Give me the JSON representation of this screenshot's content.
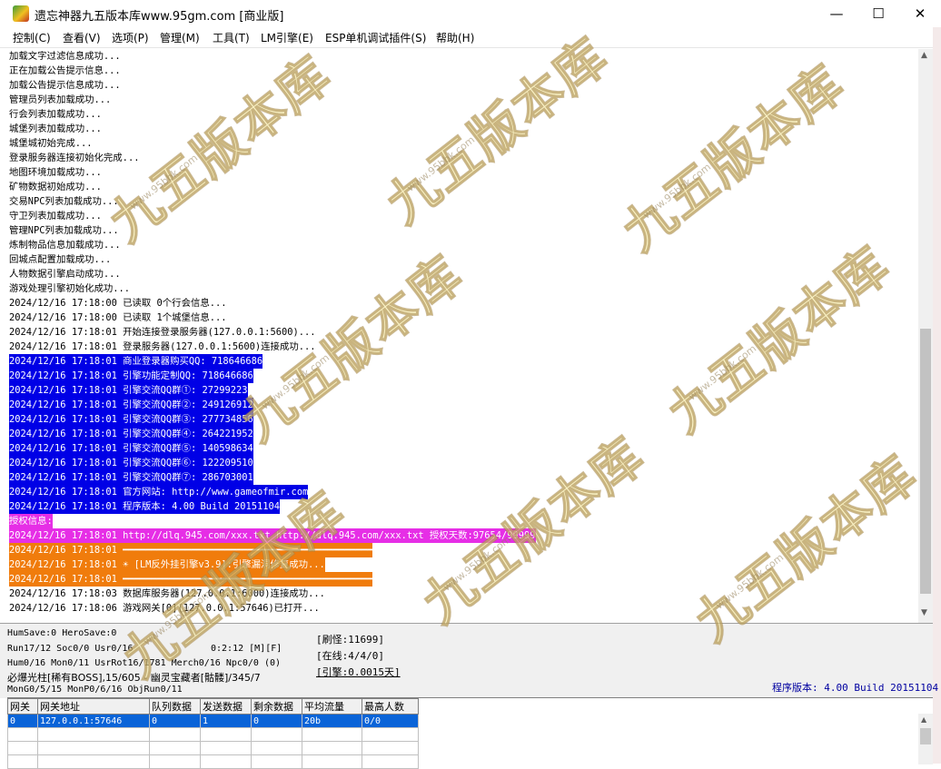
{
  "window": {
    "title": "遗忘神器九五版本库www.95gm.com [商业版]",
    "controls": {
      "minimize": "—",
      "maximize": "☐",
      "close": "✕"
    }
  },
  "menu": [
    {
      "label": "控制(C)"
    },
    {
      "label": "查看(V)"
    },
    {
      "label": "选项(P)"
    },
    {
      "label": "管理(M)"
    },
    {
      "label": "工具(T)"
    },
    {
      "label": "LM引擎(E)"
    },
    {
      "label": "ESP单机调试插件(S)"
    },
    {
      "label": "帮助(H)"
    }
  ],
  "log": [
    {
      "text": "加载文字过滤信息成功...",
      "style": "plain"
    },
    {
      "text": "正在加载公告提示信息...",
      "style": "plain"
    },
    {
      "text": "加载公告提示信息成功...",
      "style": "plain"
    },
    {
      "text": "管理员列表加载成功...",
      "style": "plain"
    },
    {
      "text": "行会列表加载成功...",
      "style": "plain"
    },
    {
      "text": "城堡列表加载成功...",
      "style": "plain"
    },
    {
      "text": "城堡城初始完成...",
      "style": "plain"
    },
    {
      "text": "登录服务器连接初始化完成...",
      "style": "plain"
    },
    {
      "text": "地图环境加载成功...",
      "style": "plain"
    },
    {
      "text": "矿物数据初始成功...",
      "style": "plain"
    },
    {
      "text": "交易NPC列表加载成功...",
      "style": "plain"
    },
    {
      "text": "守卫列表加载成功...",
      "style": "plain"
    },
    {
      "text": "管理NPC列表加载成功...",
      "style": "plain"
    },
    {
      "text": "炼制物品信息加载成功...",
      "style": "plain"
    },
    {
      "text": "回城点配置加载成功...",
      "style": "plain"
    },
    {
      "text": "人物数据引擎启动成功...",
      "style": "plain"
    },
    {
      "text": "游戏处理引擎初始化成功...",
      "style": "plain"
    },
    {
      "text": "2024/12/16 17:18:00 已读取 0个行会信息...",
      "style": "plain"
    },
    {
      "text": "2024/12/16 17:18:00 已读取 1个城堡信息...",
      "style": "plain"
    },
    {
      "text": "2024/12/16 17:18:01 开始连接登录服务器(127.0.0.1:5600)...",
      "style": "plain"
    },
    {
      "text": "2024/12/16 17:18:01 登录服务器(127.0.0.1:5600)连接成功...",
      "style": "plain"
    },
    {
      "text": "2024/12/16 17:18:01 商业登录器购买QQ: 718646686",
      "style": "blue"
    },
    {
      "text": "2024/12/16 17:18:01 引擎功能定制QQ: 718646686",
      "style": "blue"
    },
    {
      "text": "2024/12/16 17:18:01 引擎交流QQ群①: 27299223",
      "style": "blue"
    },
    {
      "text": "2024/12/16 17:18:01 引擎交流QQ群②: 249126912",
      "style": "blue"
    },
    {
      "text": "2024/12/16 17:18:01 引擎交流QQ群③: 277734856",
      "style": "blue"
    },
    {
      "text": "2024/12/16 17:18:01 引擎交流QQ群④: 264221952",
      "style": "blue"
    },
    {
      "text": "2024/12/16 17:18:01 引擎交流QQ群⑤: 140598634",
      "style": "blue"
    },
    {
      "text": "2024/12/16 17:18:01 引擎交流QQ群⑥: 122209510",
      "style": "blue"
    },
    {
      "text": "2024/12/16 17:18:01 引擎交流QQ群⑦: 286703001",
      "style": "blue"
    },
    {
      "text": "2024/12/16 17:18:01 官方网站: http://www.gameofmir.com",
      "style": "blue"
    },
    {
      "text": "2024/12/16 17:18:01 程序版本: 4.00 Build 20151104",
      "style": "blue"
    },
    {
      "text": "授权信息:",
      "style": "magenta"
    },
    {
      "text": "2024/12/16 17:18:01 http://dlq.945.com/xxx.txt http://dlq.945.com/xxx.txt 授权天数:97654/99999",
      "style": "magenta"
    },
    {
      "text": "2024/12/16 17:18:01 ━━━━━━━━━━━━━━━━━━━━━━━━━━━━━━━━━━━━━━━━━━━━",
      "style": "orange"
    },
    {
      "text": "2024/12/16 17:18:01 ☀ [LM反外挂引擎v3.9]:引擎漏洞修复成功...",
      "style": "orange"
    },
    {
      "text": "2024/12/16 17:18:01 ━━━━━━━━━━━━━━━━━━━━━━━━━━━━━━━━━━━━━━━━━━━━",
      "style": "orange"
    },
    {
      "text": "2024/12/16 17:18:03 数据库服务器(127.0.0.1:6000)连接成功...",
      "style": "plain"
    },
    {
      "text": "2024/12/16 17:18:06 游戏网关[0](127.0.0.1:57646)已打开...",
      "style": "plain"
    }
  ],
  "stats": {
    "humsave": "HumSave:0 HeroSave:0",
    "run": "Run17/12 Soc0/0 Usr0/16",
    "time": "0:2:12 [M][F]",
    "hum": "Hum0/16 Mon0/11 UsrRot16/1781 Merch0/16 Npc0/0 (0)",
    "boss": "必爆光柱[稀有BOSS],15/605 - 幽灵宝藏者[骷髅]/345/7",
    "mong": "MonG0/5/15 MonP0/6/16 ObjRun0/11",
    "refresh": "[刷怪:11699]",
    "online": "[在线:4/4/0]",
    "engine": "[引擎:0.0015天]",
    "version": "程序版本: 4.00 Build 20151104"
  },
  "gateway_table": {
    "columns": [
      "网关",
      "网关地址",
      "队列数据",
      "发送数据",
      "剩余数据",
      "平均流量",
      "最高人数"
    ],
    "rows": [
      [
        "0",
        "127.0.0.1:57646",
        "0",
        "1",
        "0",
        "20b",
        "0/0"
      ]
    ]
  },
  "watermark": {
    "text": "九五版本库",
    "url": "www.95bbk.com"
  },
  "colors": {
    "highlight_blue": "#0000e6",
    "highlight_magenta": "#e62ee6",
    "highlight_orange": "#f07c0c",
    "row_select": "#0a64d8"
  }
}
